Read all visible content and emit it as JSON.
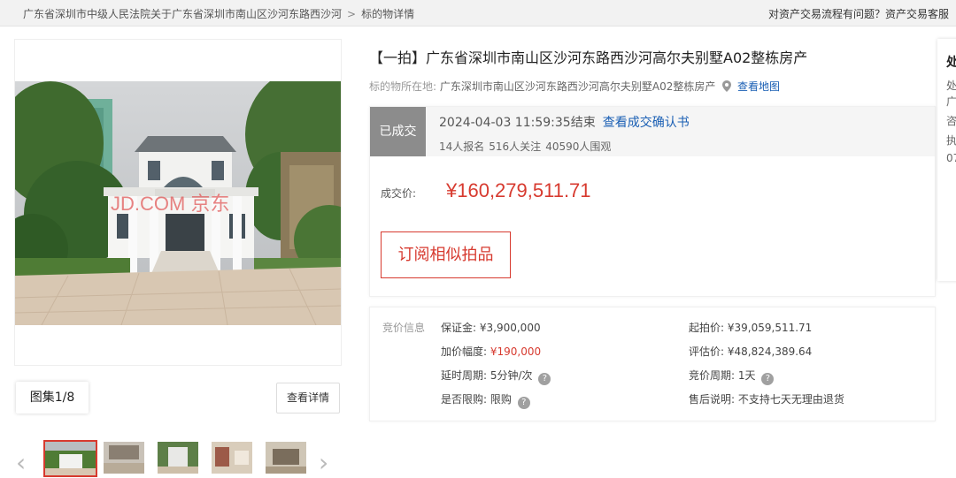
{
  "breadcrumb": {
    "items": [
      "广东省深圳市中级人民法院关于广东省深圳市南山区沙河东路西沙河",
      "标的物详情"
    ],
    "separator": ">"
  },
  "help_text": "对资产交易流程有问题？资产交易客服",
  "gallery": {
    "album_label": "图集1/8",
    "detail_label": "查看详情",
    "watermark": "JD.COM 京东"
  },
  "title": "【一拍】广东省深圳市南山区沙河东路西沙河高尔夫别墅A02整栋房产",
  "location": {
    "label": "标的物所在地:",
    "address": "广东深圳市南山区沙河东路西沙河高尔夫别墅A02整栋房产",
    "map_link": "查看地图"
  },
  "status": {
    "badge": "已成交",
    "end_time": "2024-04-03 11:59:35结束",
    "confirm_link": "查看成交确认书",
    "signups": "14人报名",
    "watchers": "516人关注",
    "viewers": "40590人围观"
  },
  "deal": {
    "price_label": "成交价:",
    "price": "¥160,279,511.71",
    "subscribe_label": "订阅相似拍品"
  },
  "bid_info": {
    "heading": "竞价信息",
    "deposit_label": "保证金:",
    "deposit_value": "¥3,900,000",
    "start_label": "起拍价:",
    "start_value": "¥39,059,511.71",
    "increment_label": "加价幅度:",
    "increment_value": "¥190,000",
    "appraisal_label": "评估价:",
    "appraisal_value": "¥48,824,389.64",
    "delay_label": "延时周期:",
    "delay_value": "5分钟/次",
    "cycle_label": "竞价周期:",
    "cycle_value": "1天",
    "limit_label": "是否限购:",
    "limit_value": "限购",
    "aftersale_label": "售后说明:",
    "aftersale_value": "不支持七天无理由退货"
  },
  "side_card": {
    "title": "处",
    "lines": [
      "处",
      "广",
      "咨",
      "执",
      "07"
    ]
  },
  "colors": {
    "accent_red": "#d73a2f",
    "link_blue": "#1a5fb4",
    "badge_gray": "#8c8c8c"
  }
}
